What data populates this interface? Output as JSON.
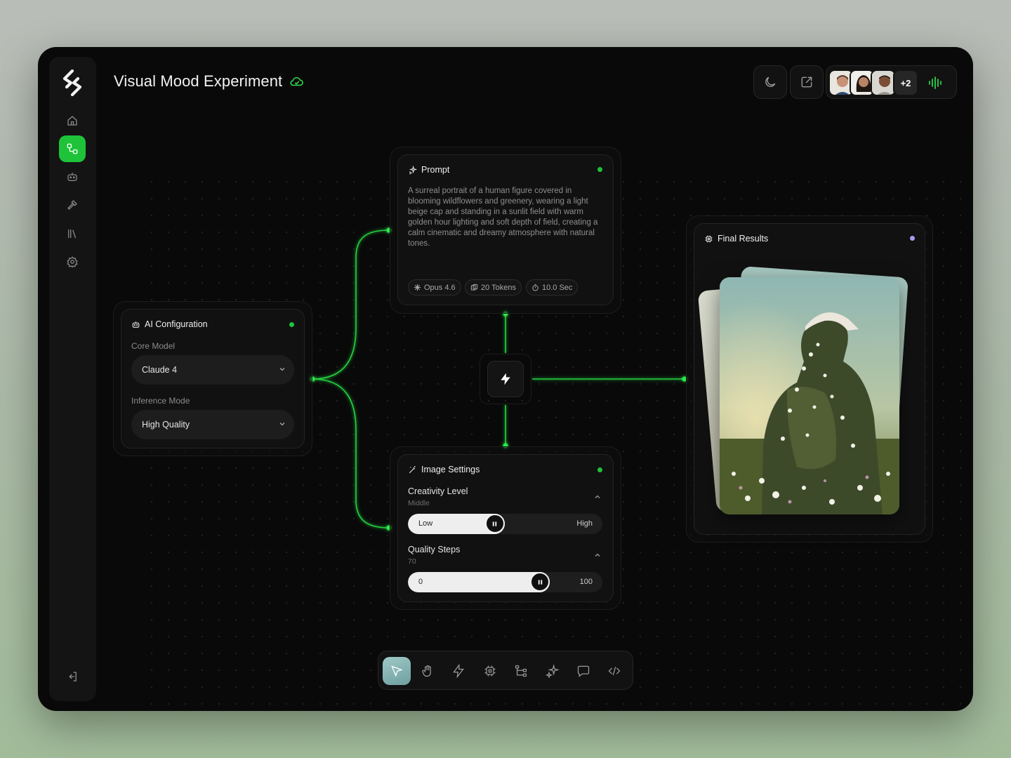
{
  "app": {
    "title": "Visual Mood Experiment",
    "accent": "#1ec33a"
  },
  "sidebar": {
    "items": [
      {
        "name": "home",
        "icon": "home-icon"
      },
      {
        "name": "workflow",
        "icon": "workflow-icon",
        "active": true
      },
      {
        "name": "bot",
        "icon": "robot-icon"
      },
      {
        "name": "tools",
        "icon": "hammer-icon"
      },
      {
        "name": "library",
        "icon": "library-icon"
      },
      {
        "name": "settings",
        "icon": "gear-icon"
      }
    ],
    "footer_icon": "logout-icon"
  },
  "header": {
    "theme_icon": "moon-icon",
    "share_icon": "external-link-icon",
    "collaborators_extra": "+2",
    "audio_icon": "waveform-icon"
  },
  "ai_config": {
    "title": "AI Configuration",
    "status_color": "#1ec33a",
    "core_model_label": "Core Model",
    "core_model_value": "Claude 4",
    "inference_label": "Inference Mode",
    "inference_value": "High Quality"
  },
  "prompt": {
    "title": "Prompt",
    "status_color": "#1ec33a",
    "text": "A surreal portrait of a human figure covered in blooming wildflowers and greenery, wearing a light beige cap and standing in a sunlit field with warm golden hour lighting and soft depth of field, creating a calm cinematic and dreamy atmosphere with natural tones.",
    "chips": {
      "model": "Opus 4.6",
      "tokens": "20 Tokens",
      "time": "10.0 Sec"
    }
  },
  "image_settings": {
    "title": "Image Settings",
    "status_color": "#1ec33a",
    "creativity": {
      "label": "Creativity Level",
      "value_text": "Middle",
      "min_label": "Low",
      "max_label": "High",
      "fraction": 0.44
    },
    "quality": {
      "label": "Quality Steps",
      "value_text": "70",
      "min_label": "0",
      "max_label": "100",
      "fraction": 0.7
    }
  },
  "final_results": {
    "title": "Final Results",
    "status_color": "#a89cf0"
  },
  "toolbar": {
    "tools": [
      {
        "name": "select",
        "icon": "cursor-icon",
        "active": true
      },
      {
        "name": "pan",
        "icon": "hand-icon"
      },
      {
        "name": "trigger",
        "icon": "bolt-icon"
      },
      {
        "name": "processor",
        "icon": "chip-icon"
      },
      {
        "name": "branch",
        "icon": "branch-icon"
      },
      {
        "name": "ai",
        "icon": "sparkle-icon"
      },
      {
        "name": "comment",
        "icon": "comment-icon"
      },
      {
        "name": "code",
        "icon": "code-icon"
      }
    ]
  }
}
